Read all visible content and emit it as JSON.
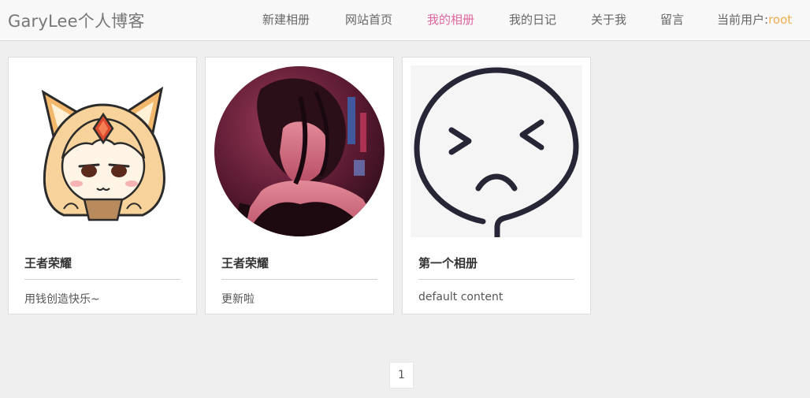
{
  "brand": "GaryLee个人博客",
  "nav": {
    "items": [
      {
        "label": "新建相册",
        "active": false
      },
      {
        "label": "网站首页",
        "active": false
      },
      {
        "label": "我的相册",
        "active": true
      },
      {
        "label": "我的日记",
        "active": false
      },
      {
        "label": "关于我",
        "active": false
      },
      {
        "label": "留言",
        "active": false
      }
    ],
    "user_prefix": "当前用户:",
    "user_name": "root"
  },
  "albums": [
    {
      "title": "王者荣耀",
      "description": "用钱创造快乐~",
      "image_icon": "fox-girl-avatar-icon"
    },
    {
      "title": "王者荣耀",
      "description": "更新啦",
      "image_icon": "portrait-photo-icon"
    },
    {
      "title": "第一个相册",
      "description": "default content",
      "image_icon": "sad-face-icon"
    }
  ],
  "pagination": {
    "current_page": "1"
  },
  "colors": {
    "active_nav": "#e066a0",
    "user_name": "#f0ad4e",
    "page_bg": "#efefef"
  }
}
